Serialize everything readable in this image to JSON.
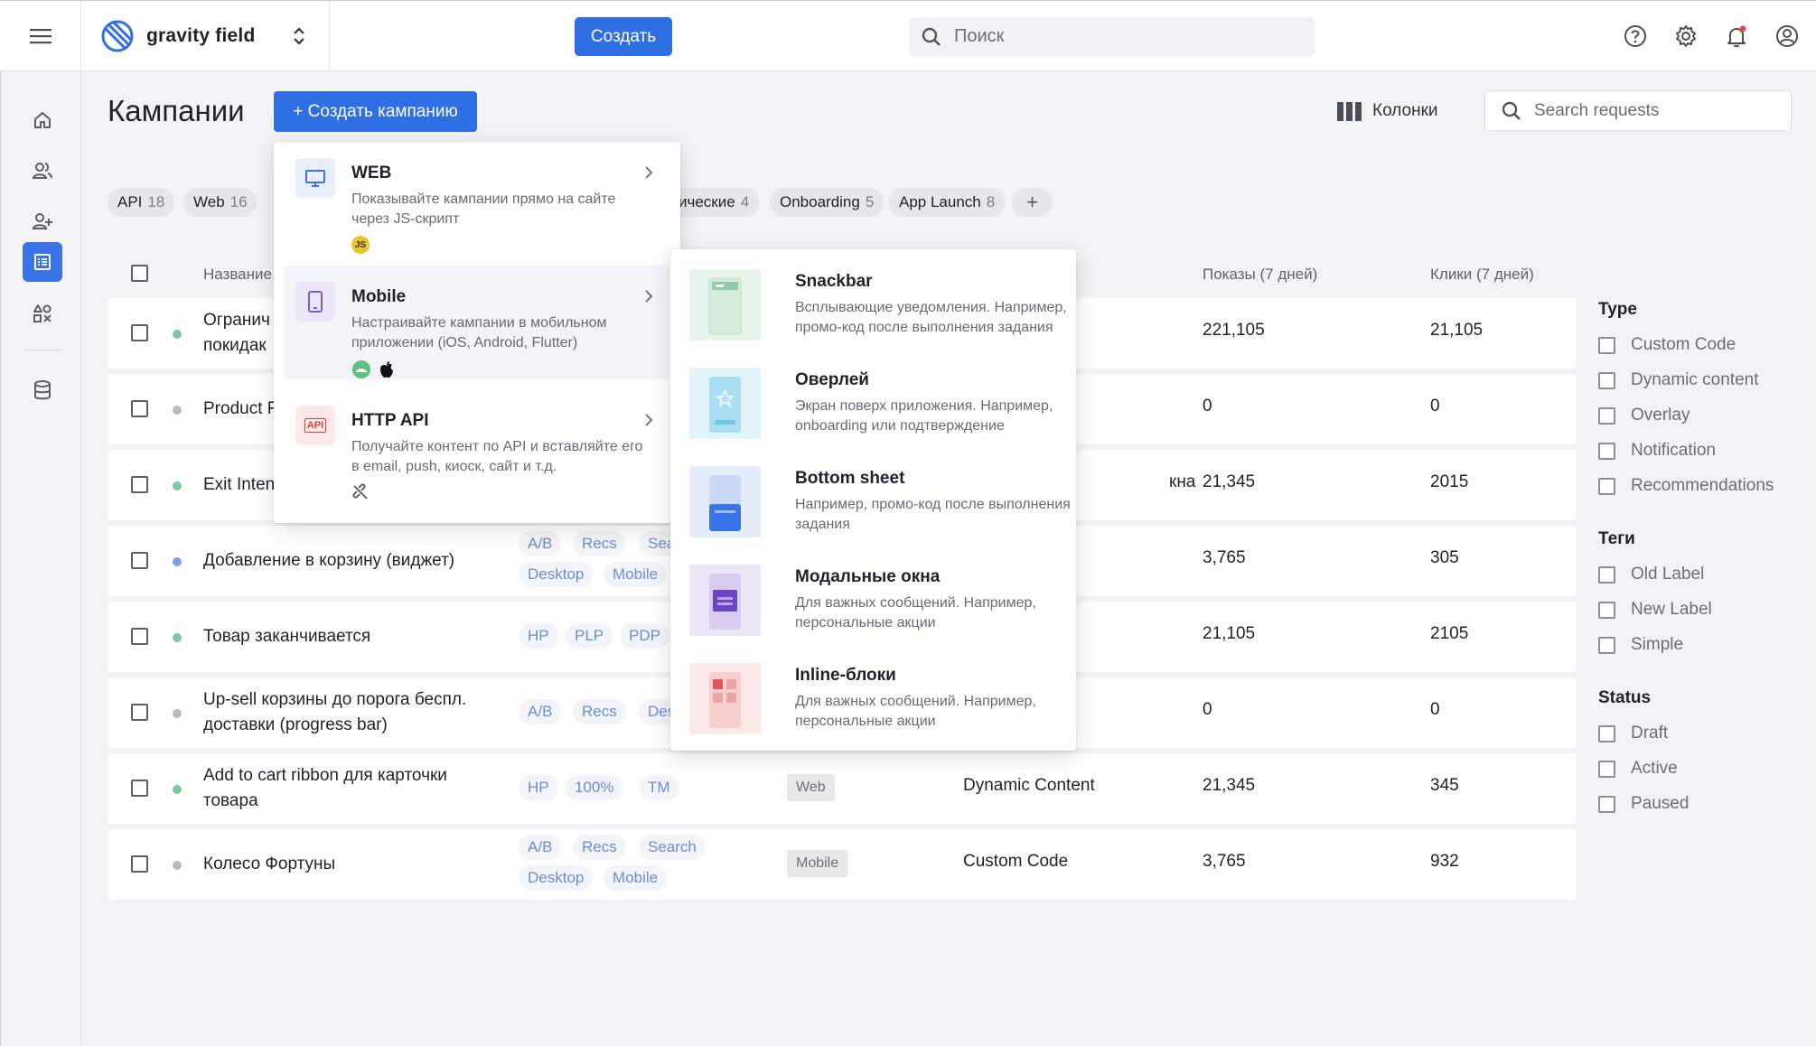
{
  "app": {
    "brand_name": "gravity field",
    "create_label": "Создать",
    "search_placeholder": "Поиск"
  },
  "page": {
    "title": "Кампании",
    "create_campaign_label": "+ Создать кампанию",
    "columns_label": "Колонки",
    "search_requests_placeholder": "Search requests"
  },
  "chips": [
    {
      "label": "API",
      "count": "18"
    },
    {
      "label": "Web",
      "count": "16"
    },
    {
      "label": "ические",
      "count": "4"
    },
    {
      "label": "Onboarding",
      "count": "5"
    },
    {
      "label": "App Launch",
      "count": "8"
    }
  ],
  "table": {
    "headers": {
      "name": "Название",
      "impressions": "Показы (7 дней)",
      "clicks": "Клики (7 дней)"
    },
    "rows": [
      {
        "name_line1": "Огранич",
        "name_line2": "покидак",
        "status": "green",
        "tags": [],
        "platform": "",
        "type": "",
        "impressions": "221,105",
        "clicks": "21,105"
      },
      {
        "name_line1": "Product F",
        "name_line2": "",
        "status": "gray",
        "tags": [],
        "platform": "",
        "type": "",
        "impressions": "0",
        "clicks": "0"
      },
      {
        "name_line1": "Exit Inten",
        "name_line2": "",
        "status": "green",
        "tags": [],
        "platform": "",
        "type": "кна",
        "impressions": "21,345",
        "clicks": "2015"
      },
      {
        "name_line1": "Добавление в корзину (виджет)",
        "name_line2": "",
        "status": "blue",
        "tags": [
          "A/B",
          "Recs",
          "Sea",
          "Desktop",
          "Mobile"
        ],
        "platform": "",
        "type": "",
        "impressions": "3,765",
        "clicks": "305"
      },
      {
        "name_line1": "Товар заканчивается",
        "name_line2": "",
        "status": "green",
        "tags": [
          "HP",
          "PLP",
          "PDP"
        ],
        "platform": "",
        "type": "",
        "impressions": "21,105",
        "clicks": "2105"
      },
      {
        "name_line1": "Up-sell корзины до порога беспл.",
        "name_line2": "доставки (progress bar)",
        "status": "gray",
        "tags": [
          "A/B",
          "Recs",
          "Des"
        ],
        "platform": "",
        "type": "",
        "impressions": "0",
        "clicks": "0"
      },
      {
        "name_line1": "Add to cart ribbon для карточки",
        "name_line2": "товара",
        "status": "green",
        "tags": [
          "HP",
          "100%",
          "TM"
        ],
        "platform": "Web",
        "type": "Dynamic Content",
        "impressions": "21,345",
        "clicks": "345"
      },
      {
        "name_line1": "Колесо Фортуны",
        "name_line2": "",
        "status": "gray",
        "tags": [
          "A/B",
          "Recs",
          "Search",
          "Desktop",
          "Mobile"
        ],
        "platform": "Mobile",
        "type": "Custom Code",
        "impressions": "3,765",
        "clicks": "932"
      }
    ]
  },
  "filters": {
    "type_title": "Type",
    "type_items": [
      "Custom Code",
      "Dynamic content",
      "Overlay",
      "Notification",
      "Recommendations"
    ],
    "tags_title": "Теги",
    "tags_items": [
      "Old Label",
      "New Label",
      "Simple"
    ],
    "status_title": "Status",
    "status_items": [
      "Draft",
      "Active",
      "Paused"
    ]
  },
  "dropdown": {
    "items": [
      {
        "title": "WEB",
        "desc": "Показывайте кампании прямо на сайте через JS-скрипт",
        "badge": "JS"
      },
      {
        "title": "Mobile",
        "desc": "Настраивайте кампании в мобильном приложении (iOS, Android, Flutter)"
      },
      {
        "title": "HTTP API",
        "desc": "Получайте контент по API и вставляйте его в email, push, киоск, сайт и т.д.",
        "icon_text": "API"
      }
    ]
  },
  "submenu": {
    "items": [
      {
        "title": "Snackbar",
        "desc": "Всплывающие уведомления. Например, промо-код после выполнения задания"
      },
      {
        "title": "Оверлей",
        "desc": "Экран поверх приложения. Например, onboarding или подтверждение"
      },
      {
        "title": "Bottom sheet",
        "desc": "Например, промо-код после выполнения задания"
      },
      {
        "title": "Модальные окна",
        "desc": "Для важных сообщений. Например, персональные акции"
      },
      {
        "title": "Inline-блоки",
        "desc": "Для важных сообщений. Например, персональные акции"
      }
    ]
  },
  "colors": {
    "accent": "#2f6fe4",
    "status_green": "#7cc9a0",
    "status_gray": "#b8babe",
    "status_blue": "#7aa2ea"
  }
}
